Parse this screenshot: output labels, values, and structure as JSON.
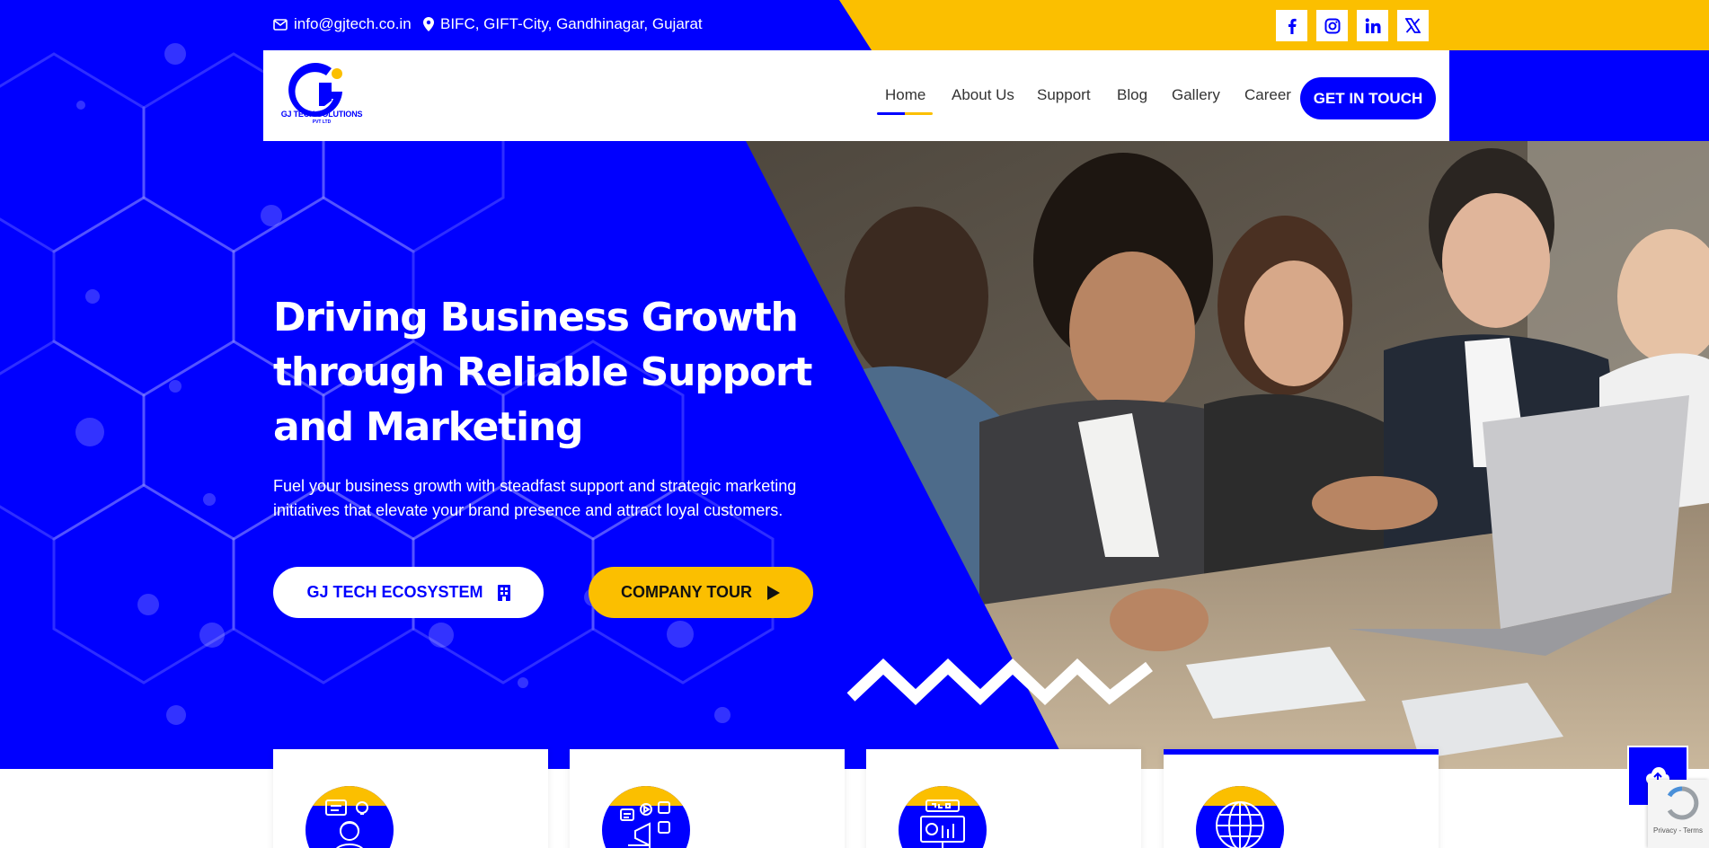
{
  "topbar": {
    "email": "info@gjtech.co.in",
    "address": "BIFC, GIFT-City, Gandhinagar, Gujarat",
    "socials": [
      {
        "label": "f",
        "icon": "facebook-icon"
      },
      {
        "label": "instagram",
        "icon": "instagram-icon"
      },
      {
        "label": "in",
        "icon": "linkedin-icon"
      },
      {
        "label": "X",
        "icon": "x-twitter-icon"
      }
    ]
  },
  "navbar": {
    "logo_text": "GJ TECH SOLUTIONS",
    "logo_sub": "PVT LTD",
    "items": [
      "Home",
      "About Us",
      "Support",
      "Blog",
      "Gallery",
      "Career"
    ],
    "active": "Home",
    "cta": "GET IN TOUCH"
  },
  "hero": {
    "title": "Driving Business Growth through Reliable Support and Marketing",
    "subtitle": "Fuel your business growth with steadfast support and strategic marketing initiatives that elevate your brand presence and attract loyal customers.",
    "btn_primary": "GJ TECH ECOSYSTEM",
    "btn_secondary": "COMPANY TOUR"
  },
  "cards": [
    {
      "icon": "customer-support-icon"
    },
    {
      "icon": "digital-marketing-icon"
    },
    {
      "icon": "seo-icon"
    },
    {
      "icon": "web-globe-icon",
      "active": true
    }
  ],
  "recaptcha": {
    "text": "Privacy - Terms"
  },
  "colors": {
    "brand_blue": "#0000ff",
    "accent_yellow": "#fbbf00",
    "white": "#ffffff"
  }
}
